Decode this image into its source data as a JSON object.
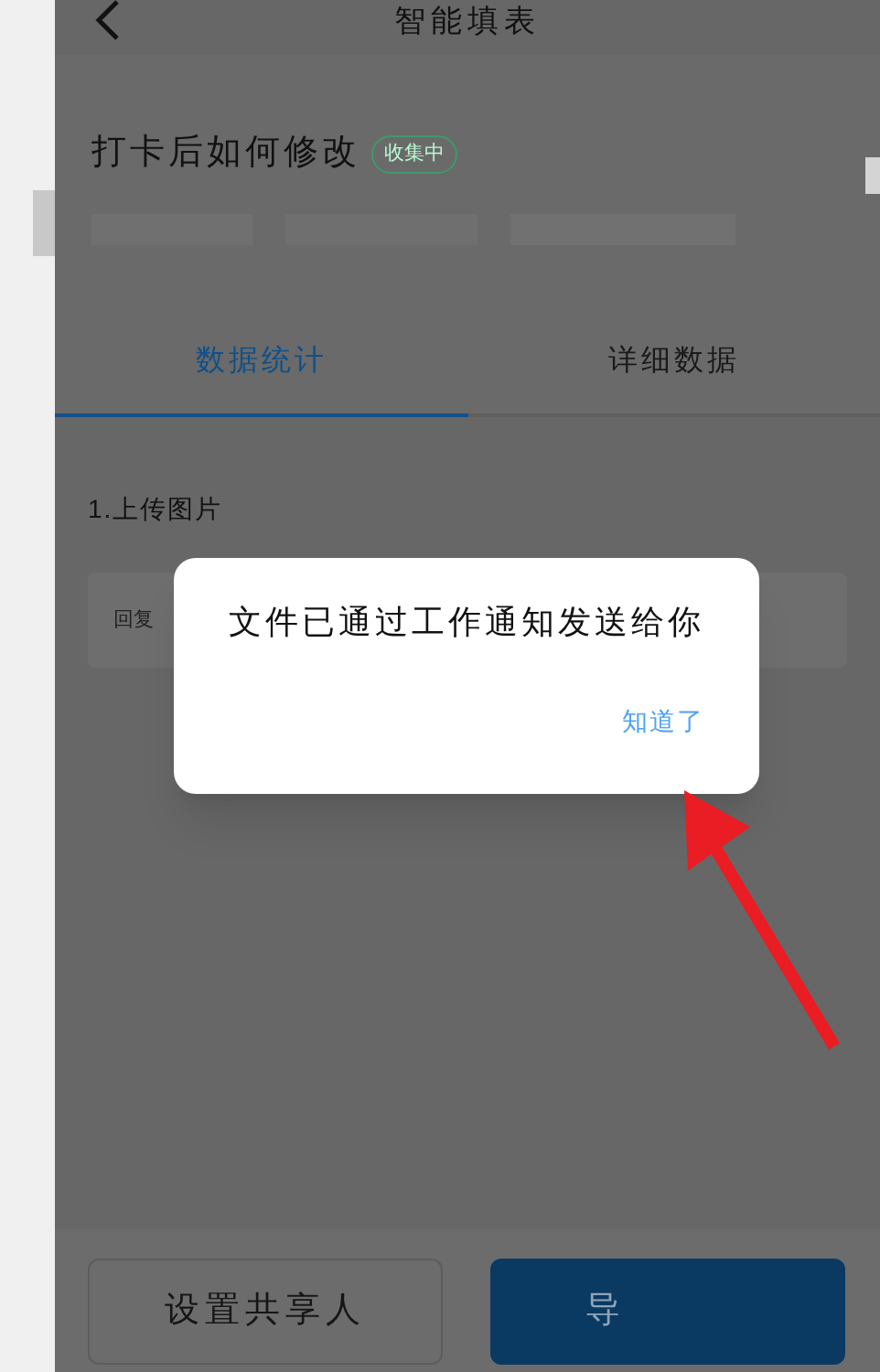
{
  "header": {
    "title": "智能填表"
  },
  "form": {
    "title": "打卡后如何修改",
    "status_badge": "收集中"
  },
  "tabs": [
    {
      "label": "数据统计",
      "selected": true
    },
    {
      "label": "详细数据",
      "selected": false
    }
  ],
  "question": {
    "title": "1.上传图片",
    "answer_preview": "回复"
  },
  "dialog": {
    "message": "文件已通过工作通知发送给你",
    "button": "知道了"
  },
  "bottom_buttons": [
    {
      "label": "设置共享人",
      "kind": "outline"
    },
    {
      "label": "导",
      "kind": "primary"
    }
  ]
}
